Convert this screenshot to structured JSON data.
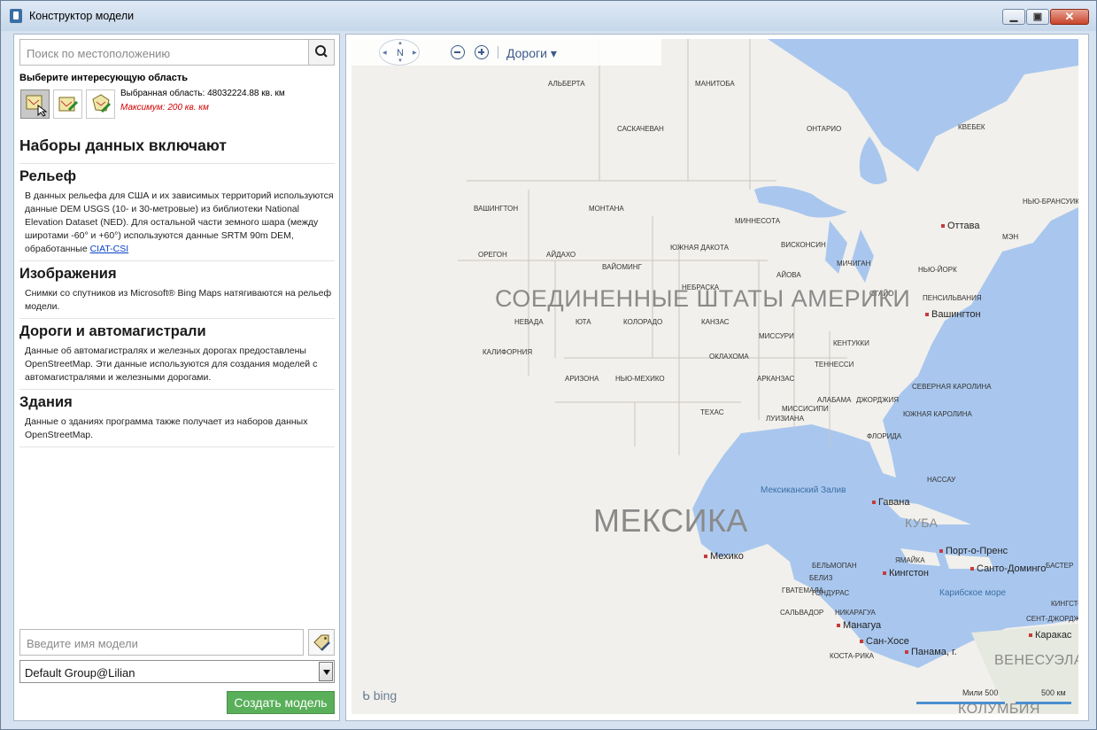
{
  "window": {
    "title": "Конструктор модели"
  },
  "search": {
    "placeholder": "Поиск по местоположению"
  },
  "area": {
    "title": "Выберите интересующую область",
    "selected": "Выбранная область: 48032224.88 кв. км",
    "maximum": "Максимум: 200 кв. км"
  },
  "datasets": {
    "heading": "Наборы данных включают",
    "sections": [
      {
        "title": "Рельеф",
        "text": "В данных рельефа для США и их зависимых территорий используются данные DEM USGS (10- и 30-метровые) из библиотеки National Elevation Dataset (NED). Для остальной части земного шара (между широтами -60° и +60°) используются данные SRTM 90m DEM, обработанные ",
        "link": "CIAT-CSI"
      },
      {
        "title": "Изображения",
        "text": "Снимки со спутников из Microsoft® Bing Maps натягиваются на рельеф модели."
      },
      {
        "title": "Дороги и автомагистрали",
        "text": "Данные об автомагистралях и железных дорогах предоставлены OpenStreetMap. Эти данные используются для создания моделей с автомагистралями и железными дорогами."
      },
      {
        "title": "Здания",
        "text": "Данные о зданиях программа также получает из наборов данных OpenStreetMap."
      }
    ]
  },
  "model": {
    "name_placeholder": "Введите имя модели",
    "group": "Default Group@Lilian",
    "create_label": "Создать модель"
  },
  "map": {
    "compass": "N",
    "style": "Дороги ▾",
    "brand": "bing",
    "scale_miles": "Мили 500",
    "scale_km": "500 км",
    "labels": [
      "Альберта",
      "Манитоба",
      "Саскачеван",
      "Онтарио",
      "Квебек",
      "Вашингтон",
      "Монтана",
      "Миннесота",
      "Нью-Брансуик",
      "Орегон",
      "Айдахо",
      "Южная Дакота",
      "Висконсин",
      "Мэн",
      "Вайоминг",
      "Мичиган",
      "Небраска",
      "Айова",
      "Невада",
      "Юта",
      "Колорадо",
      "Канзас",
      "Пенсильвания",
      "Миссури",
      "Кентукки",
      "Калифорния",
      "Оклахома",
      "Теннесси",
      "Аризона",
      "Нью-Мехико",
      "Арканзас",
      "Северная Каролина",
      "Миссисипи",
      "Алабама",
      "Джорджия",
      "Южная Каролина",
      "Техас",
      "Луизиана",
      "Флорида",
      "Ямайка",
      "Гватемала",
      "Гондурас",
      "Белиз",
      "Сальвадор",
      "Никарагуа",
      "Коста-Рика"
    ],
    "cities": [
      "Оттава",
      "Нью-Йорк",
      "Вашингтон",
      "Нассау",
      "Гавана",
      "Порт-о-Пренс",
      "Санто-Доминго",
      "Кингстон",
      "Мехико",
      "Бельмопан",
      "Манагуа",
      "Сан-Хосе",
      "Панама, г.",
      "Каракас",
      "Бастер",
      "Кингстон",
      "Сент-Джорджс",
      "Огайо"
    ],
    "countries": [
      "СОЕДИНЕННЫЕ ШТАТЫ АМЕРИКИ",
      "МЕКСИКА",
      "КУБА",
      "ВЕНЕСУЭЛА",
      "КОЛУМБИЯ"
    ],
    "seas": [
      "Мексиканский Залив",
      "Карибское море"
    ],
    "colors": {
      "water": "#a9c7ee",
      "land": "#f2f0ec",
      "button": "#5aaf5a"
    }
  }
}
